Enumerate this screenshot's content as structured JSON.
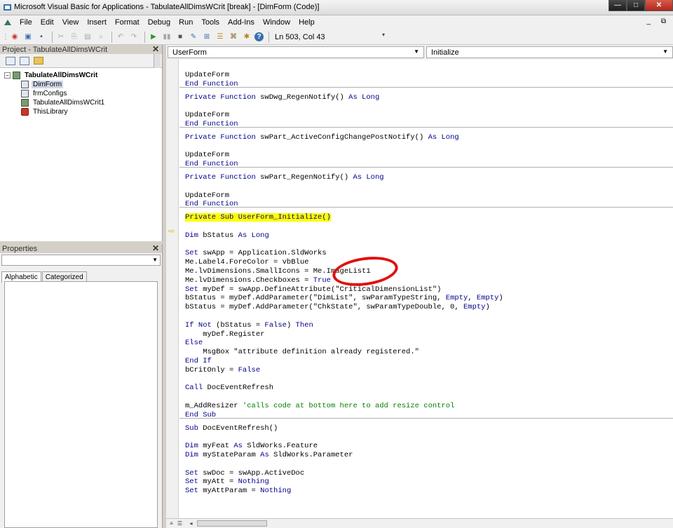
{
  "window": {
    "title": "Microsoft Visual Basic for Applications - TabulateAllDimsWCrit [break] - [DimForm (Code)]",
    "min": "—",
    "max": "□",
    "close": "✕"
  },
  "menu": [
    "File",
    "Edit",
    "View",
    "Insert",
    "Format",
    "Debug",
    "Run",
    "Tools",
    "Add-Ins",
    "Window",
    "Help"
  ],
  "menu_mdi": "_ ⧉",
  "toolbar": {
    "position": "Ln 503, Col 43"
  },
  "project": {
    "title": "Project - TabulateAllDimsWCrit",
    "tree": [
      {
        "label": "TabulateAllDimsWCrit",
        "level": 0,
        "icon": "project-icon"
      },
      {
        "label": "DimForm",
        "level": 1,
        "icon": "userform-icon",
        "selected": true
      },
      {
        "label": "frmConfigs",
        "level": 1,
        "icon": "userform-icon"
      },
      {
        "label": "TabulateAllDimsWCrit1",
        "level": 1,
        "icon": "module-icon"
      },
      {
        "label": "ThisLibrary",
        "level": 1,
        "icon": "library-icon"
      }
    ]
  },
  "properties": {
    "title": "Properties",
    "tabs": [
      "Alphabetic",
      "Categorized"
    ]
  },
  "code": {
    "object_combo": "UserForm",
    "proc_combo": "Initialize",
    "lines": [
      {
        "t": "UpdateForm"
      },
      {
        "t": "End Function",
        "k": true
      },
      {
        "sep": true
      },
      {
        "t": "Private Function swDwg_RegenNotify() As Long",
        "mix": [
          [
            "Private Function ",
            1
          ],
          [
            "swDwg_RegenNotify() ",
            0
          ],
          [
            "As Long",
            1
          ]
        ]
      },
      {
        "t": ""
      },
      {
        "t": "UpdateForm"
      },
      {
        "t": "End Function",
        "k": true
      },
      {
        "sep": true
      },
      {
        "t": "Private Function swPart_ActiveConfigChangePostNotify() As Long",
        "mix": [
          [
            "Private Function ",
            1
          ],
          [
            "swPart_ActiveConfigChangePostNotify() ",
            0
          ],
          [
            "As Long",
            1
          ]
        ]
      },
      {
        "t": ""
      },
      {
        "t": "UpdateForm"
      },
      {
        "t": "End Function",
        "k": true
      },
      {
        "sep": true
      },
      {
        "t": "Private Function swPart_RegenNotify() As Long",
        "mix": [
          [
            "Private Function ",
            1
          ],
          [
            "swPart_RegenNotify() ",
            0
          ],
          [
            "As Long",
            1
          ]
        ]
      },
      {
        "t": ""
      },
      {
        "t": "UpdateForm"
      },
      {
        "t": "End Function",
        "k": true
      },
      {
        "sep": true
      },
      {
        "t": "Private Sub UserForm_Initialize()",
        "hl": true
      },
      {
        "t": ""
      },
      {
        "t": "Dim bStatus As Long",
        "mix": [
          [
            "Dim ",
            1
          ],
          [
            "bStatus ",
            0
          ],
          [
            "As Long",
            1
          ]
        ]
      },
      {
        "t": ""
      },
      {
        "t": "Set swApp = Application.SldWorks",
        "mix": [
          [
            "Set ",
            1
          ],
          [
            "swApp = Application.SldWorks",
            0
          ]
        ]
      },
      {
        "t": "Me.Label4.ForeColor = vbBlue"
      },
      {
        "t": "Me.lvDimensions.SmallIcons = Me.ImageList1"
      },
      {
        "t": "Me.lvDimensions.Checkboxes = True",
        "mix": [
          [
            "Me.lvDimensions.Checkboxes = ",
            0
          ],
          [
            "True",
            1
          ]
        ]
      },
      {
        "t": "Set myDef = swApp.DefineAttribute(\"CriticalDimensionList\")",
        "mix": [
          [
            "Set ",
            1
          ],
          [
            "myDef = swApp.DefineAttribute(\"CriticalDimensionList\")",
            0
          ]
        ]
      },
      {
        "t": "bStatus = myDef.AddParameter(\"DimList\", swParamTypeString, Empty, Empty)",
        "mix": [
          [
            "bStatus = myDef.AddParameter(\"DimList\", swParamTypeString, ",
            0
          ],
          [
            "Empty",
            1
          ],
          [
            ", ",
            0
          ],
          [
            "Empty",
            1
          ],
          [
            ")",
            0
          ]
        ]
      },
      {
        "t": "bStatus = myDef.AddParameter(\"ChkState\", swParamTypeDouble, 0, Empty)",
        "mix": [
          [
            "bStatus = myDef.AddParameter(\"ChkState\", swParamTypeDouble, 0, ",
            0
          ],
          [
            "Empty",
            1
          ],
          [
            ")",
            0
          ]
        ]
      },
      {
        "t": ""
      },
      {
        "t": "If Not (bStatus = False) Then",
        "mix": [
          [
            "If Not ",
            1
          ],
          [
            "(bStatus = ",
            0
          ],
          [
            "False",
            1
          ],
          [
            ") ",
            0
          ],
          [
            "Then",
            1
          ]
        ]
      },
      {
        "t": "    myDef.Register"
      },
      {
        "t": "Else",
        "k": true
      },
      {
        "t": "    MsgBox \"attribute definition already registered.\""
      },
      {
        "t": "End If",
        "k": true
      },
      {
        "t": "bCritOnly = False",
        "mix": [
          [
            "bCritOnly = ",
            0
          ],
          [
            "False",
            1
          ]
        ]
      },
      {
        "t": ""
      },
      {
        "t": "Call DocEventRefresh",
        "mix": [
          [
            "Call ",
            1
          ],
          [
            "DocEventRefresh",
            0
          ]
        ]
      },
      {
        "t": ""
      },
      {
        "t": "m_AddResizer 'calls code at bottom here to add resize control",
        "mix": [
          [
            "m_AddResizer ",
            0
          ],
          [
            "'calls code at bottom here to add resize control",
            2
          ]
        ]
      },
      {
        "t": "End Sub",
        "k": true
      },
      {
        "sep": true
      },
      {
        "t": "Sub DocEventRefresh()",
        "mix": [
          [
            "Sub ",
            1
          ],
          [
            "DocEventRefresh()",
            0
          ]
        ]
      },
      {
        "t": ""
      },
      {
        "t": "Dim myFeat As SldWorks.Feature",
        "mix": [
          [
            "Dim ",
            1
          ],
          [
            "myFeat ",
            0
          ],
          [
            "As ",
            1
          ],
          [
            "SldWorks.Feature",
            0
          ]
        ]
      },
      {
        "t": "Dim myStateParam As SldWorks.Parameter",
        "mix": [
          [
            "Dim ",
            1
          ],
          [
            "myStateParam ",
            0
          ],
          [
            "As ",
            1
          ],
          [
            "SldWorks.Parameter",
            0
          ]
        ]
      },
      {
        "t": ""
      },
      {
        "t": "Set swDoc = swApp.ActiveDoc",
        "mix": [
          [
            "Set ",
            1
          ],
          [
            "swDoc = swApp.ActiveDoc",
            0
          ]
        ]
      },
      {
        "t": "Set myAtt = Nothing",
        "mix": [
          [
            "Set ",
            1
          ],
          [
            "myAtt = ",
            0
          ],
          [
            "Nothing",
            1
          ]
        ]
      },
      {
        "t": "Set myAttParam = Nothing",
        "mix": [
          [
            "Set ",
            1
          ],
          [
            "myAttParam = ",
            0
          ],
          [
            "Nothing",
            1
          ]
        ]
      }
    ]
  },
  "colors": {
    "keyword": "#00008b",
    "comment": "#008000",
    "highlight": "#ffff00",
    "annotation": "#e01010"
  }
}
